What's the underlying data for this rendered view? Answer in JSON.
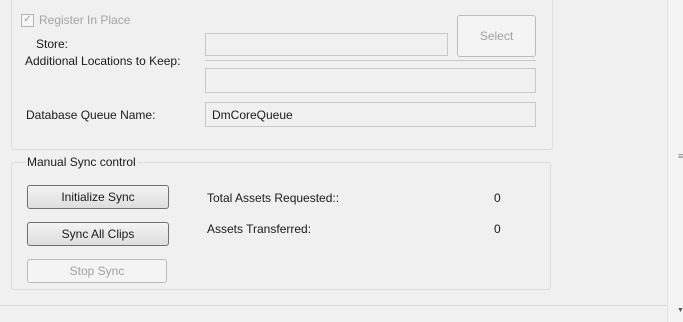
{
  "register": {
    "label": "Register In Place",
    "checked": true,
    "check_glyph": "✓"
  },
  "store": {
    "label": "Store:",
    "value": ""
  },
  "select_button": {
    "label": "Select"
  },
  "additional_locations": {
    "label": "Additional Locations to Keep:",
    "value1": "",
    "value2": ""
  },
  "database_queue": {
    "label": "Database Queue Name:",
    "value": "DmCoreQueue"
  },
  "manual_sync": {
    "title": "Manual Sync control",
    "initialize_label": "Initialize Sync",
    "sync_all_label": "Sync All  Clips",
    "stop_label": "Stop Sync",
    "total_requested_label": "Total Assets Requested::",
    "total_requested_value": "0",
    "transferred_label": "Assets Transferred:",
    "transferred_value": "0"
  },
  "scrollbar": {
    "grip_glyph": "≡",
    "arrow_glyph": "▼"
  }
}
